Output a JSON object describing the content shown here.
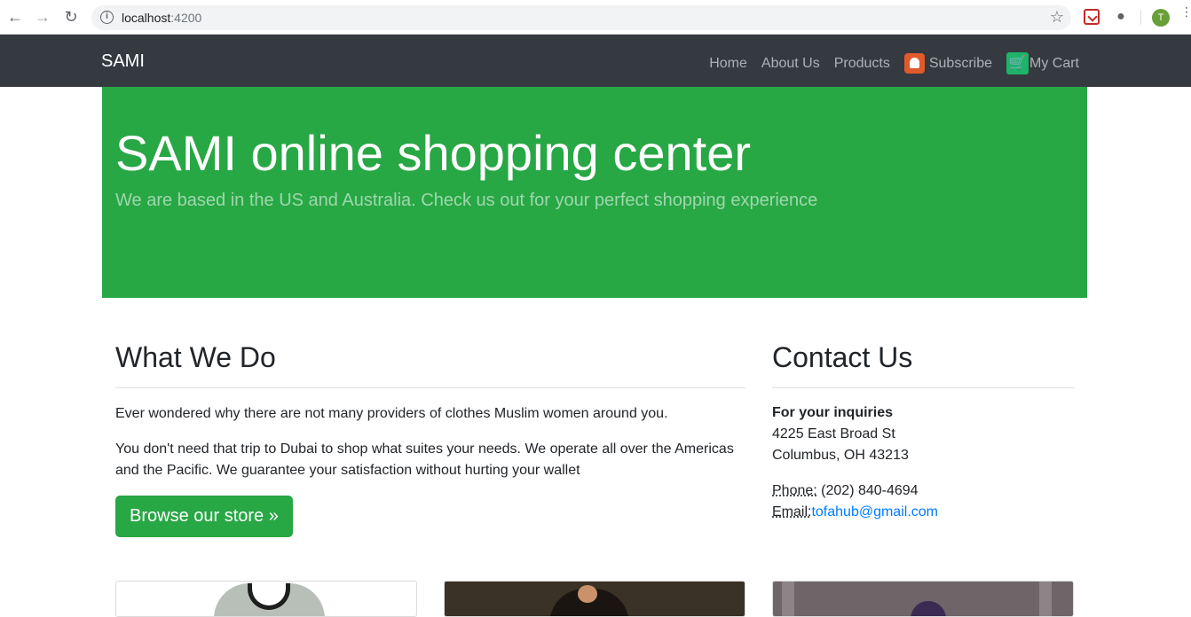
{
  "browser": {
    "url_host": "localhost",
    "url_port": ":4200",
    "avatar_letter": "T"
  },
  "navbar": {
    "brand": "SAMI",
    "links": [
      {
        "label": "Home"
      },
      {
        "label": "About Us"
      },
      {
        "label": "Products"
      },
      {
        "label": "Subscribe",
        "icon": "bell-icon"
      },
      {
        "label": "My Cart",
        "icon": "cart-icon"
      }
    ]
  },
  "jumbotron": {
    "title": "SAMI online shopping center",
    "subtitle": "We are based in the US and Australia. Check us out for your perfect shopping experience"
  },
  "what_we_do": {
    "heading": "What We Do",
    "paragraph1": "Ever wondered why there are not many providers of clothes Muslim women around you.",
    "paragraph2": "You don't need that trip to Dubai to shop what suites your needs. We operate all over the Americas and the Pacific. We guarantee your satisfaction without hurting your wallet",
    "button": "Browse our store »"
  },
  "contact": {
    "heading": "Contact Us",
    "inquiries_label": "For your inquiries",
    "address_line1": "4225 East Broad St",
    "address_line2": "Columbus, OH 43213",
    "phone_label": "Phone:",
    "phone": " (202) 840-4694",
    "email_label": "Email:",
    "email": "tofahub@gmail.com"
  },
  "colors": {
    "navbar_bg": "#343a40",
    "jumbotron_bg": "#28a745",
    "button_bg": "#28a745",
    "link": "#007bff"
  }
}
